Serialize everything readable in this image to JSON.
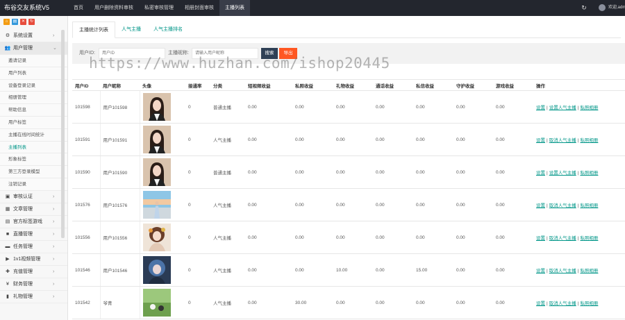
{
  "app": {
    "brand": "布谷交友系统V5",
    "user_name": "欢迎,admin",
    "nav": [
      {
        "label": "首页",
        "active": false
      },
      {
        "label": "用户删除资料审核",
        "active": false
      },
      {
        "label": "私密审核管理",
        "active": false
      },
      {
        "label": "相册封面审核",
        "active": false
      },
      {
        "label": "主播列表",
        "active": true
      }
    ]
  },
  "sidebar": {
    "quick_buttons": [
      {
        "icon": "home-icon",
        "glyph": "⌂",
        "color": "#f39c12"
      },
      {
        "icon": "document-icon",
        "glyph": "▤",
        "color": "#3498db"
      },
      {
        "icon": "trash-icon",
        "glyph": "✕",
        "color": "#e74c3c"
      },
      {
        "icon": "refresh-icon",
        "glyph": "↻",
        "color": "#e74c3c"
      }
    ],
    "menu_top": [
      {
        "label": "系统设置",
        "icon": "gear-icon",
        "glyph": "⚙",
        "open": false
      },
      {
        "label": "用户管理",
        "icon": "users-icon",
        "glyph": "👥",
        "open": true
      }
    ],
    "submenu": [
      {
        "label": "邀请记录",
        "active": false
      },
      {
        "label": "用户列表",
        "active": false
      },
      {
        "label": "设备登录记录",
        "active": false
      },
      {
        "label": "相册管理",
        "active": false
      },
      {
        "label": "帮助信息",
        "active": false
      },
      {
        "label": "用户标签",
        "active": false
      },
      {
        "label": "主播在线时间统计",
        "active": false
      },
      {
        "label": "主播列表",
        "active": true
      },
      {
        "label": "形象标签",
        "active": false
      },
      {
        "label": "第三方登录模型",
        "active": false
      },
      {
        "label": "注销记录",
        "active": false
      }
    ],
    "menu_bottom": [
      {
        "label": "审核认证",
        "icon": "shield-icon",
        "glyph": "▣"
      },
      {
        "label": "文章管理",
        "icon": "grid-icon",
        "glyph": "▦"
      },
      {
        "label": "官方标签游戏",
        "icon": "tag-icon",
        "glyph": "▤"
      },
      {
        "label": "直播管理",
        "icon": "camera-icon",
        "glyph": "■"
      },
      {
        "label": "任务管理",
        "icon": "task-icon",
        "glyph": "▬"
      },
      {
        "label": "1v1视频管理",
        "icon": "video-icon",
        "glyph": "▶"
      },
      {
        "label": "充值管理",
        "icon": "cart-icon",
        "glyph": "✚"
      },
      {
        "label": "财务管理",
        "icon": "yen-icon",
        "glyph": "¥"
      },
      {
        "label": "礼物管理",
        "icon": "gift-icon",
        "glyph": "▮"
      }
    ]
  },
  "tabs": [
    {
      "label": "主播统计列表",
      "active": true
    },
    {
      "label": "人气主播",
      "active": false
    },
    {
      "label": "人气主播排名",
      "active": false
    }
  ],
  "search": {
    "label1": "用户ID:",
    "placeholder1": "用户ID",
    "label2": "主播昵称:",
    "placeholder2": "请输入用户昵称",
    "button": "搜索",
    "export": "导出"
  },
  "table": {
    "columns": [
      "用户ID",
      "用户昵称",
      "头像",
      "接通率",
      "分类",
      "短视频收益",
      "私照收益",
      "礼物收益",
      "通话收益",
      "私信收益",
      "守护收益",
      "游戏收益",
      "操作"
    ],
    "rows": [
      {
        "id": "101598",
        "nick": "用户101598",
        "avatar": "a1",
        "rate": "0",
        "category": "普通主播",
        "v1": "0.00",
        "v2": "0.00",
        "v3": "0.00",
        "v4": "0.00",
        "v5": "0.00",
        "v6": "0.00",
        "v7": "0.00",
        "ops": [
          "设置",
          "设置人气主播",
          "私照相册"
        ]
      },
      {
        "id": "101591",
        "nick": "用户101591",
        "avatar": "a1",
        "rate": "0",
        "category": "人气主播",
        "v1": "0.00",
        "v2": "0.00",
        "v3": "0.00",
        "v4": "0.00",
        "v5": "0.00",
        "v6": "0.00",
        "v7": "0.00",
        "ops": [
          "设置",
          "取消人气主播",
          "私照相册"
        ]
      },
      {
        "id": "101590",
        "nick": "用户101590",
        "avatar": "a1",
        "rate": "0",
        "category": "普通主播",
        "v1": "0.00",
        "v2": "0.00",
        "v3": "0.00",
        "v4": "0.00",
        "v5": "0.00",
        "v6": "0.00",
        "v7": "0.00",
        "ops": [
          "设置",
          "设置人气主播",
          "私照相册"
        ]
      },
      {
        "id": "101576",
        "nick": "用户101576",
        "avatar": "a2",
        "rate": "0",
        "category": "人气主播",
        "v1": "0.00",
        "v2": "0.00",
        "v3": "0.00",
        "v4": "0.00",
        "v5": "0.00",
        "v6": "0.00",
        "v7": "0.00",
        "ops": [
          "设置",
          "取消人气主播",
          "私照相册"
        ]
      },
      {
        "id": "101556",
        "nick": "用户101556",
        "avatar": "a3",
        "rate": "0",
        "category": "人气主播",
        "v1": "0.00",
        "v2": "0.00",
        "v3": "0.00",
        "v4": "0.00",
        "v5": "0.00",
        "v6": "0.00",
        "v7": "0.00",
        "ops": [
          "设置",
          "取消人气主播",
          "私照相册"
        ]
      },
      {
        "id": "101546",
        "nick": "用户101546",
        "avatar": "a4",
        "rate": "0",
        "category": "人气主播",
        "v1": "0.00",
        "v2": "0.00",
        "v3": "10.00",
        "v4": "0.00",
        "v5": "15.00",
        "v6": "0.00",
        "v7": "0.00",
        "ops": [
          "设置",
          "取消人气主播",
          "私照相册"
        ]
      },
      {
        "id": "101542",
        "nick": "爷青",
        "avatar": "a5",
        "rate": "0",
        "category": "人气主播",
        "v1": "0.00",
        "v2": "30.00",
        "v3": "0.00",
        "v4": "0.00",
        "v5": "0.00",
        "v6": "0.00",
        "v7": "0.00",
        "ops": [
          "设置",
          "取消人气主播",
          "私照相册"
        ]
      }
    ]
  },
  "watermark": "https://www.huzhan.com/ishop20445"
}
